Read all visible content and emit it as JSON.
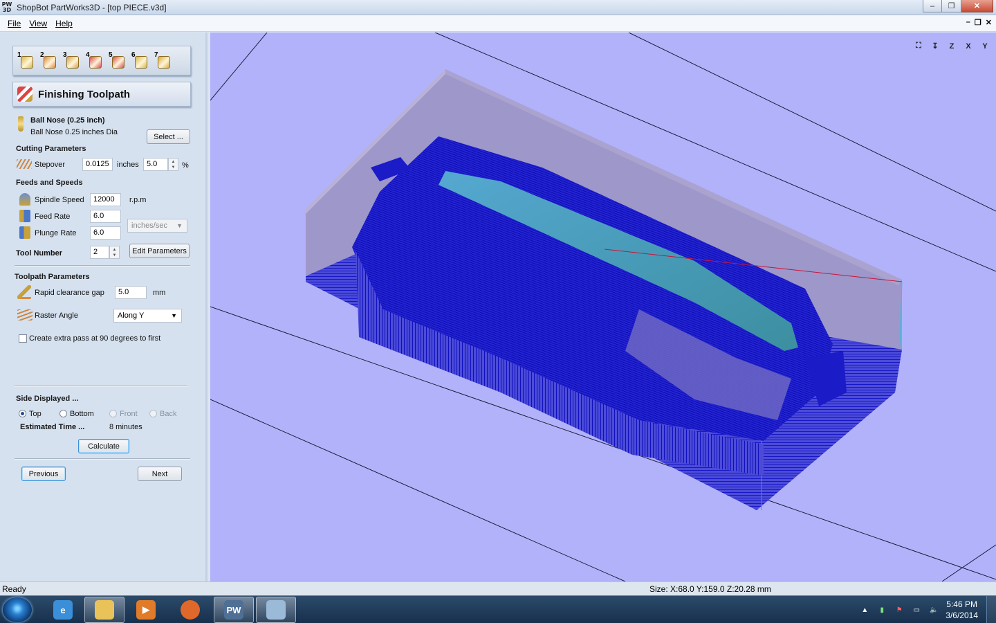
{
  "window": {
    "app_icon_text": "PW 3D",
    "title": "ShopBot PartWorks3D - [top PIECE.v3d]",
    "minimize": "–",
    "maximize": "❐",
    "close": "✕"
  },
  "menu": {
    "items": [
      "File",
      "View",
      "Help"
    ],
    "mdi_minimize": "–",
    "mdi_restore": "❐",
    "mdi_close": "✕"
  },
  "panel": {
    "steps": [
      {
        "num": "1",
        "icon": "block-setup-icon",
        "color": "#d9b84a"
      },
      {
        "num": "2",
        "icon": "position-icon",
        "color": "#e0873a"
      },
      {
        "num": "3",
        "icon": "roughing-icon",
        "color": "#d5a04a"
      },
      {
        "num": "4",
        "icon": "finishing-icon",
        "color": "#d9474d"
      },
      {
        "num": "5",
        "icon": "cutout-icon",
        "color": "#d9474d"
      },
      {
        "num": "6",
        "icon": "preview-icon",
        "color": "#d9b84a"
      },
      {
        "num": "7",
        "icon": "save-icon",
        "color": "#d9a93a"
      }
    ],
    "header_title": "Finishing Toolpath",
    "tool": {
      "name": "Ball Nose (0.25 inch)",
      "desc": "Ball Nose 0.25 inches Dia",
      "select_label": "Select ..."
    },
    "cutting": {
      "title": "Cutting Parameters",
      "stepover_label": "Stepover",
      "stepover_value": "0.0125",
      "stepover_unit": "inches",
      "stepover_pct": "5.0",
      "pct_symbol": "%"
    },
    "feeds": {
      "title": "Feeds and Speeds",
      "spindle_label": "Spindle Speed",
      "spindle_value": "12000",
      "spindle_unit": "r.p.m",
      "feed_label": "Feed Rate",
      "feed_value": "6.0",
      "plunge_label": "Plunge Rate",
      "plunge_value": "6.0",
      "rate_unit": "inches/sec",
      "tool_number_label": "Tool Number",
      "tool_number_value": "2",
      "edit_label": "Edit Parameters"
    },
    "toolpath": {
      "title": "Toolpath Parameters",
      "rapid_label": "Rapid clearance gap",
      "rapid_value": "5.0",
      "rapid_unit": "mm",
      "raster_label": "Raster Angle",
      "raster_value": "Along Y",
      "extra_pass_label": "Create extra pass at 90 degrees to first",
      "extra_pass_checked": false
    },
    "side": {
      "title": "Side Displayed ...",
      "options": [
        "Top",
        "Bottom",
        "Front",
        "Back"
      ],
      "selected": "Top",
      "est_label": "Estimated Time ...",
      "est_value": "8 minutes",
      "calculate_label": "Calculate"
    },
    "nav": {
      "previous_label": "Previous",
      "next_label": "Next"
    }
  },
  "viewport": {
    "background": "#b2b2fb",
    "toolpath_color": "#0000c8",
    "view_buttons": [
      "fit-view-icon",
      "iso-view-icon",
      "z-view-icon",
      "x-view-icon",
      "y-view-icon"
    ],
    "view_labels": [
      "⛶",
      "↧",
      "Z",
      "X",
      "Y"
    ]
  },
  "status": {
    "left": "Ready",
    "right": "Size: X:68.0 Y:159.0 Z:20.28 mm"
  },
  "taskbar": {
    "apps": [
      {
        "name": "ie",
        "icon": "internet-explorer-icon",
        "label": "e",
        "color": "#3a8fd8"
      },
      {
        "name": "explorer",
        "icon": "folder-icon",
        "label": "",
        "color": "#e9c35a"
      },
      {
        "name": "media",
        "icon": "media-player-icon",
        "label": "▶",
        "color": "#e07b2a"
      },
      {
        "name": "firefox",
        "icon": "firefox-icon",
        "label": "",
        "color": "#e0682a"
      },
      {
        "name": "partworks",
        "icon": "partworks-icon",
        "label": "PW",
        "color": "#4f6f95"
      },
      {
        "name": "paint",
        "icon": "paint-icon",
        "label": "",
        "color": "#9bbad8"
      }
    ],
    "time": "5:46 PM",
    "date": "3/6/2014"
  }
}
